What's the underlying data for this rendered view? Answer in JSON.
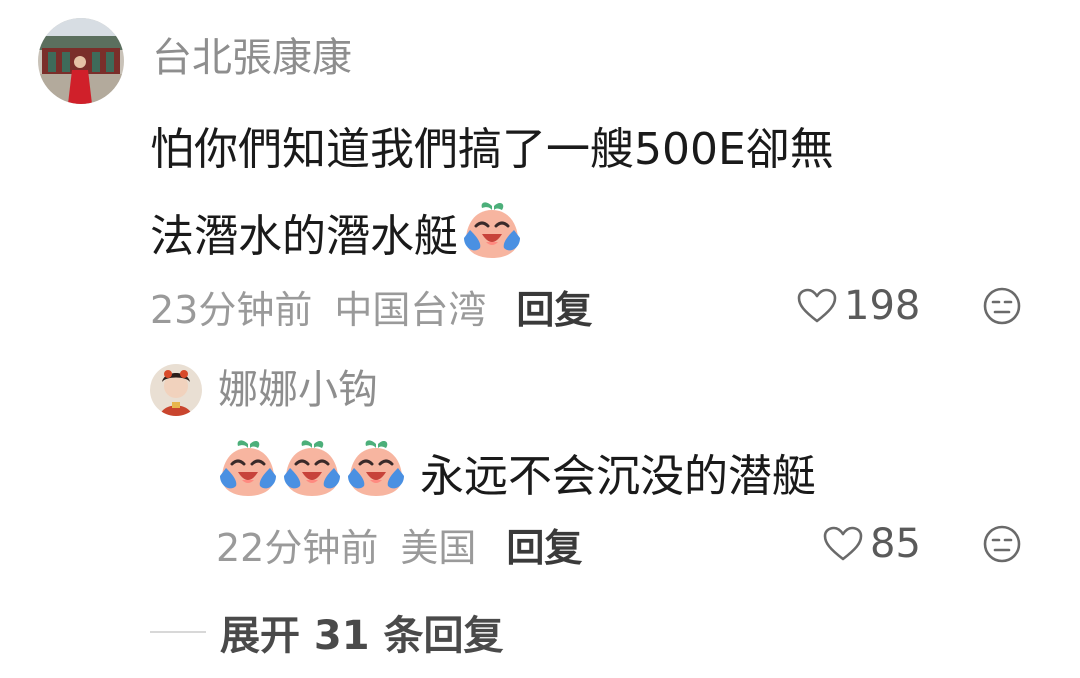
{
  "comment": {
    "username": "台北張康康",
    "text_line1": "怕你們知道我們搞了一艘500E卻無",
    "text_line2": "法潛水的潛水艇",
    "emoji_icon": "crying-laughing-peach-emoji",
    "time": "23分钟前",
    "location": "中国台湾",
    "reply_label": "回复",
    "likes": "198"
  },
  "reply": {
    "username": "娜娜小钩",
    "emoji_icon": "crying-laughing-peach-emoji",
    "emoji_count": 3,
    "text": "永远不会沉没的潜艇",
    "time": "22分钟前",
    "location": "美国",
    "reply_label": "回复",
    "likes": "85"
  },
  "expand": {
    "label": "展开 31 条回复"
  },
  "colors": {
    "username": "#8e8e8e",
    "body_text": "#1a1a1a",
    "meta_text": "#9a9a9a",
    "reply_button": "#3a3a3a",
    "peach_emoji": "#f7b5a0",
    "tear_drop": "#4a90e2",
    "leaf": "#4caf7a"
  }
}
